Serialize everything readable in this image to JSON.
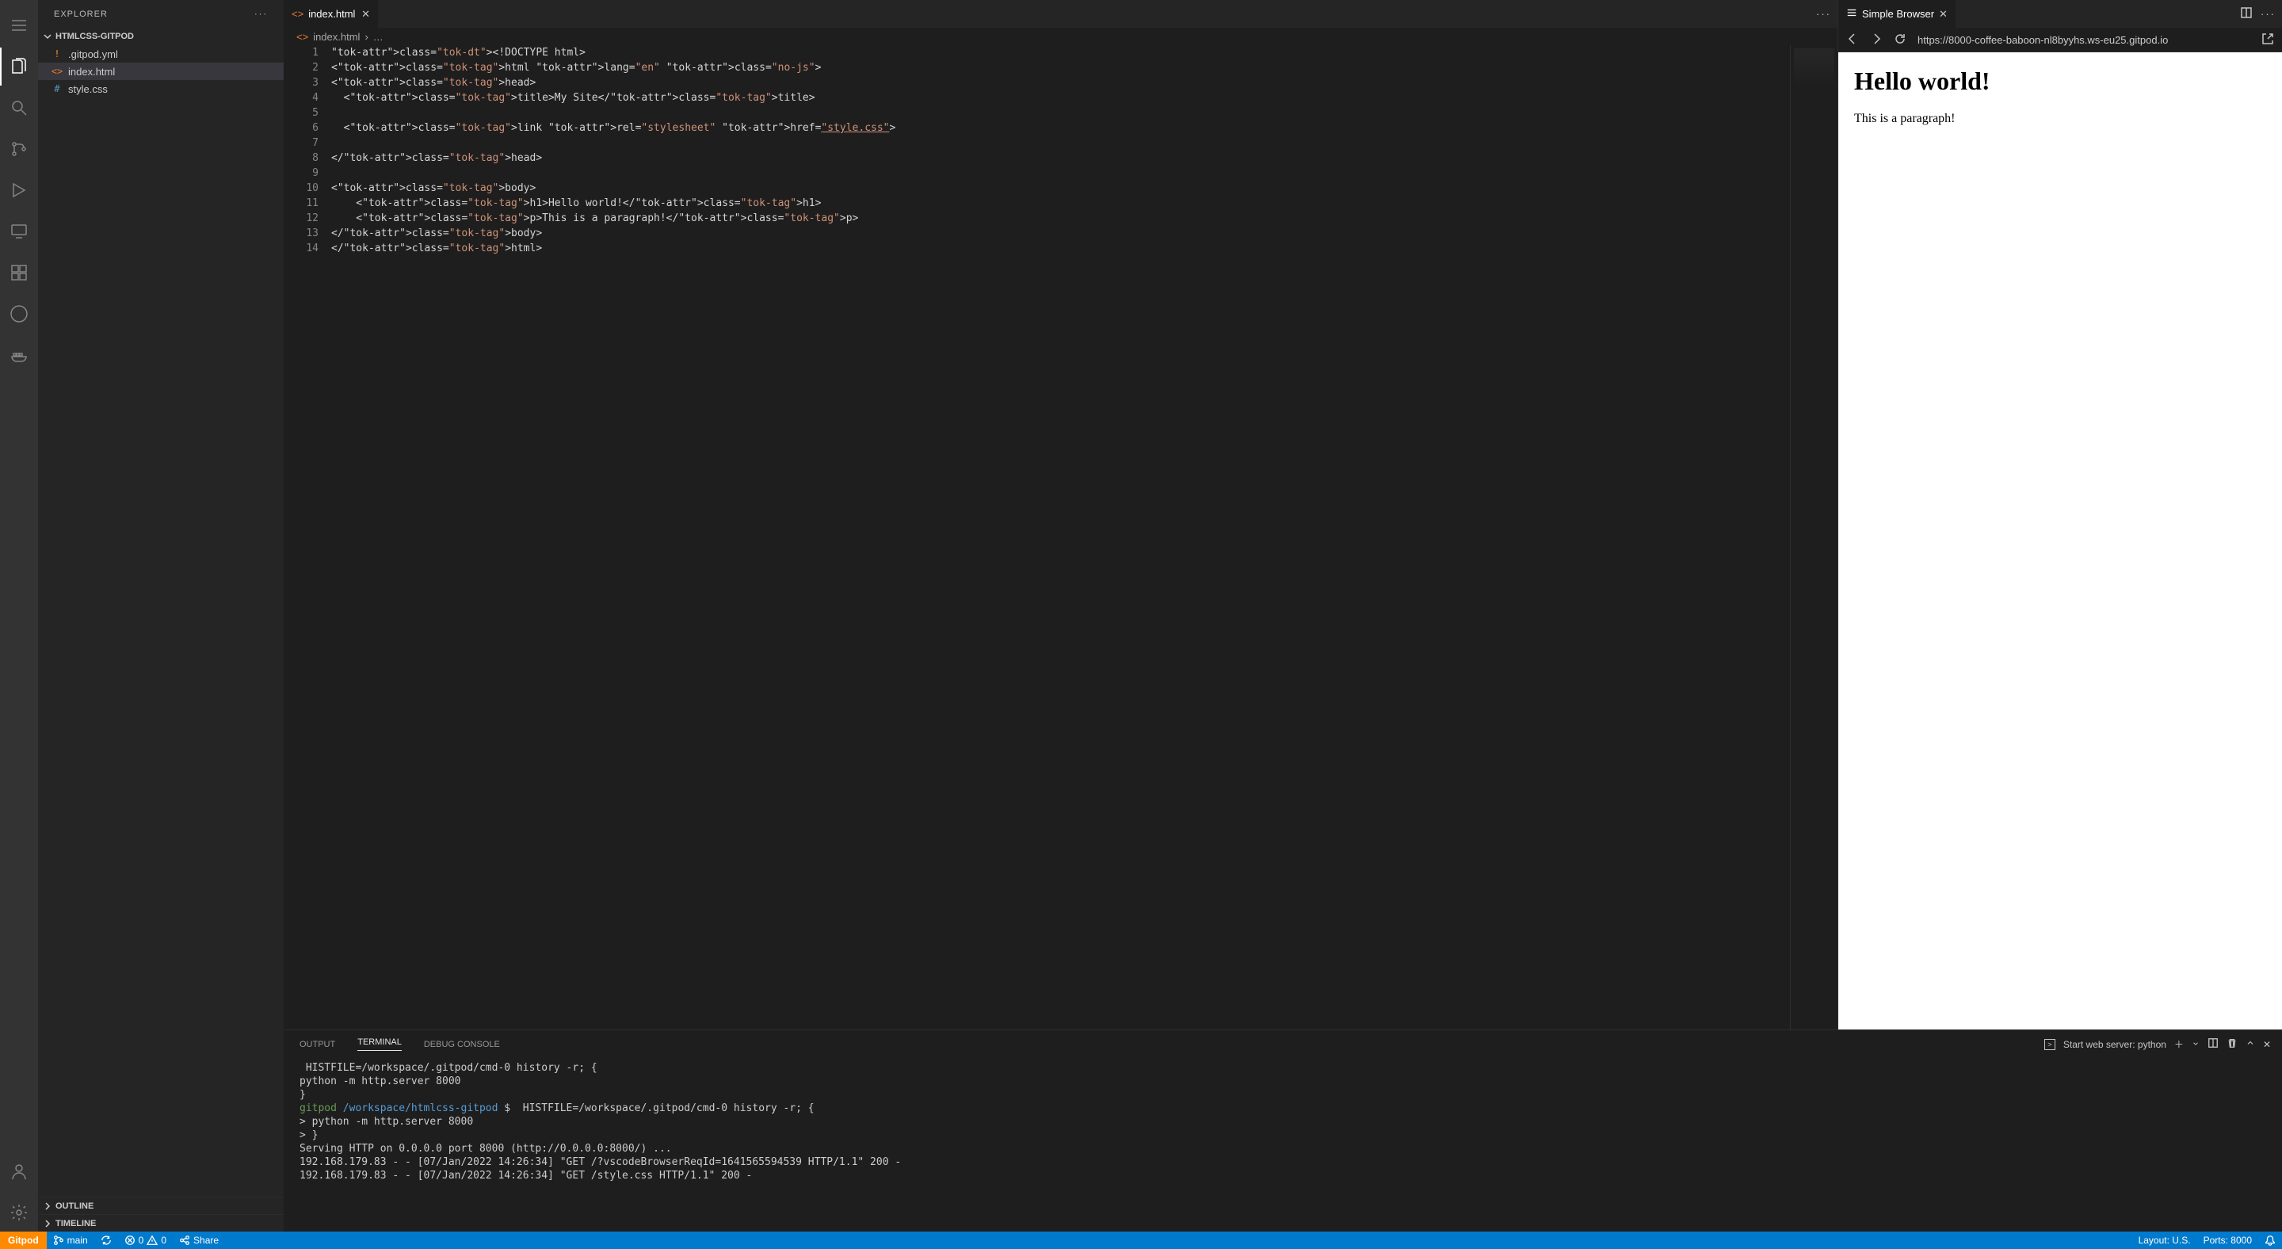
{
  "sidebar": {
    "title": "EXPLORER",
    "folder": "HTMLCSS-GITPOD",
    "files": [
      {
        "name": ".gitpod.yml",
        "icon": "!",
        "iconClass": "fi-yml"
      },
      {
        "name": "index.html",
        "icon": "<>",
        "iconClass": "fi-html",
        "selected": true
      },
      {
        "name": "style.css",
        "icon": "#",
        "iconClass": "fi-css"
      }
    ],
    "sections": [
      "OUTLINE",
      "TIMELINE"
    ]
  },
  "editor": {
    "tab": {
      "label": "index.html",
      "icon": "<>"
    },
    "breadcrumb": [
      "index.html",
      "…"
    ],
    "gutter": "1\n2\n3\n4\n5\n6\n7\n8\n9\n10\n11\n12\n13\n14",
    "src": {
      "l1": "<!DOCTYPE html>",
      "l2": "<html lang=\"en\" class=\"no-js\">",
      "l3": "<head>",
      "l4": "  <title>My Site</title>",
      "l5": "",
      "l6": "  <link rel=\"stylesheet\" href=\"style.css\">",
      "l7": "",
      "l8": "</head>",
      "l9": "",
      "l10": "<body>",
      "l11": "    <h1>Hello world!</h1>",
      "l12": "    <p>This is a paragraph!</p>",
      "l13": "</body>",
      "l14": "</html>"
    }
  },
  "browser": {
    "tab": "Simple Browser",
    "url": "https://8000-coffee-baboon-nl8byyhs.ws-eu25.gitpod.io",
    "body_h1": "Hello world!",
    "body_p": "This is a paragraph!"
  },
  "panel": {
    "tabs": [
      "OUTPUT",
      "TERMINAL",
      "DEBUG CONSOLE"
    ],
    "active_tab": 1,
    "task_label": "Start web server: python",
    "terminal": [
      " HISTFILE=/workspace/.gitpod/cmd-0 history -r; {",
      "python -m http.server 8000",
      "}",
      {
        "prompt_user": "gitpod",
        "prompt_path": "/workspace/htmlcss-gitpod",
        "rest": " $  HISTFILE=/workspace/.gitpod/cmd-0 history -r; {"
      },
      "> python -m http.server 8000",
      "> }",
      "Serving HTTP on 0.0.0.0 port 8000 (http://0.0.0.0:8000/) ...",
      "192.168.179.83 - - [07/Jan/2022 14:26:34] \"GET /?vscodeBrowserReqId=1641565594539 HTTP/1.1\" 200 -",
      "192.168.179.83 - - [07/Jan/2022 14:26:34] \"GET /style.css HTTP/1.1\" 200 -"
    ]
  },
  "status": {
    "gitpod": "Gitpod",
    "branch": "main",
    "errors": "0",
    "warnings": "0",
    "share": "Share",
    "layout": "Layout: U.S.",
    "ports": "Ports: 8000"
  }
}
